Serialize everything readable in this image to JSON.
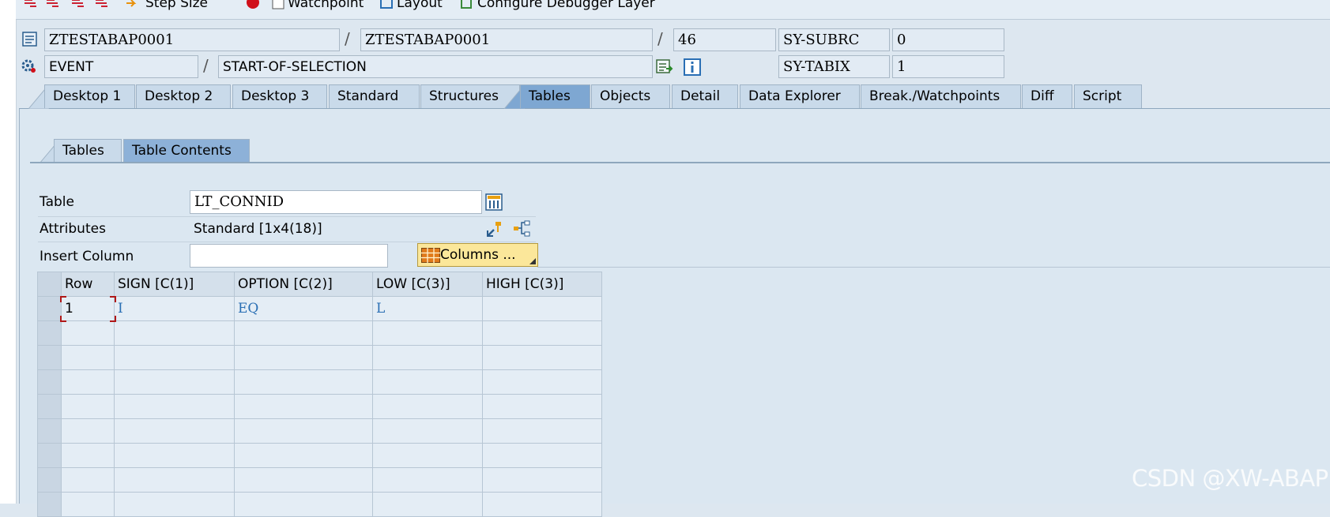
{
  "toolbar": {
    "step_size": "Step Size",
    "watchpoint": "Watchpoint",
    "layout": "Layout",
    "configure_layer": "Configure Debugger Layer"
  },
  "header": {
    "program": "ZTESTABAP0001",
    "include": "ZTESTABAP0001",
    "line": "46",
    "subrc_label": "SY-SUBRC",
    "subrc_value": "0",
    "event_type": "EVENT",
    "event_name": "START-OF-SELECTION",
    "tabix_label": "SY-TABIX",
    "tabix_value": "1"
  },
  "tabs": [
    "Desktop 1",
    "Desktop 2",
    "Desktop 3",
    "Standard",
    "Structures",
    "Tables",
    "Objects",
    "Detail",
    "Data Explorer",
    "Break./Watchpoints",
    "Diff",
    "Script"
  ],
  "subtabs": [
    "Tables",
    "Table Contents"
  ],
  "form": {
    "table_label": "Table",
    "table_value": "LT_CONNID",
    "attributes_label": "Attributes",
    "attributes_value": "Standard [1x4(18)]",
    "insert_column_label": "Insert Column",
    "insert_column_value": "",
    "columns_button": "Columns ..."
  },
  "grid": {
    "headers": [
      "Row",
      "SIGN [C(1)]",
      "OPTION [C(2)]",
      "LOW [C(3)]",
      "HIGH [C(3)]"
    ],
    "rows": [
      [
        "1",
        "I",
        "EQ",
        "L",
        ""
      ]
    ]
  },
  "watermark": "CSDN @XW-ABAP",
  "colors": {
    "active_tab": "#7ea7d2",
    "columns_button": "#fbe79a",
    "cell_value": "#2a6fb4"
  }
}
